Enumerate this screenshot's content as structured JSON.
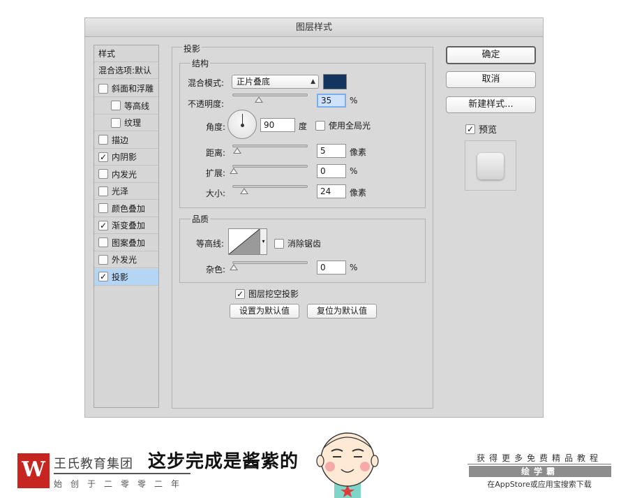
{
  "dialog": {
    "title": "图层样式",
    "styles_header": "样式",
    "blend_options": "混合选项:默认",
    "style_items": [
      {
        "label": "斜面和浮雕",
        "checked": false,
        "indent": false
      },
      {
        "label": "等高线",
        "checked": false,
        "indent": true
      },
      {
        "label": "纹理",
        "checked": false,
        "indent": true
      },
      {
        "label": "描边",
        "checked": false,
        "indent": false
      },
      {
        "label": "内阴影",
        "checked": true,
        "indent": false
      },
      {
        "label": "内发光",
        "checked": false,
        "indent": false
      },
      {
        "label": "光泽",
        "checked": false,
        "indent": false
      },
      {
        "label": "颜色叠加",
        "checked": false,
        "indent": false
      },
      {
        "label": "渐变叠加",
        "checked": true,
        "indent": false
      },
      {
        "label": "图案叠加",
        "checked": false,
        "indent": false
      },
      {
        "label": "外发光",
        "checked": false,
        "indent": false
      },
      {
        "label": "投影",
        "checked": true,
        "indent": false,
        "selected": true
      }
    ],
    "section_title": "投影",
    "structure": {
      "title": "结构",
      "blend_mode_label": "混合模式:",
      "blend_mode_value": "正片叠底",
      "shadow_color": "#12345f",
      "opacity_label": "不透明度:",
      "opacity_value": "35",
      "opacity_unit": "%",
      "opacity_fraction": 0.35,
      "angle_label": "角度:",
      "angle_value": "90",
      "angle_unit": "度",
      "global_light_label": "使用全局光",
      "distance_label": "距离:",
      "distance_value": "5",
      "distance_unit": "像素",
      "spread_label": "扩展:",
      "spread_value": "0",
      "spread_unit": "%",
      "size_label": "大小:",
      "size_value": "24",
      "size_unit": "像素"
    },
    "quality": {
      "title": "品质",
      "contour_label": "等高线:",
      "antialias_label": "消除锯齿",
      "noise_label": "杂色:",
      "noise_value": "0",
      "noise_unit": "%"
    },
    "knockout_label": "图层挖空投影",
    "set_default": "设置为默认值",
    "reset_default": "复位为默认值",
    "ok": "确定",
    "cancel": "取消",
    "new_style": "新建样式...",
    "preview_label": "预览",
    "check_mark": "✓"
  },
  "footer": {
    "logo_letter": "W",
    "brand": "王氏教育集团",
    "tagline": "始创于二零零二年",
    "caption": "这步完成是酱紫的",
    "right_top": "获得更多免费精品教程",
    "right_mid": "绘学霸",
    "right_bottom": "在AppStore或应用宝搜索下载"
  }
}
